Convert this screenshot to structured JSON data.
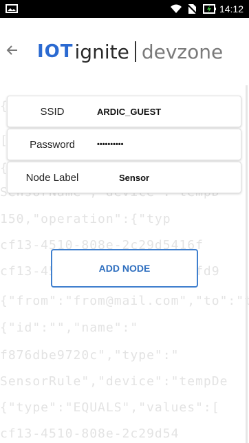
{
  "status_bar": {
    "time": "14:12",
    "icons": [
      "image-icon",
      "wifi-icon",
      "no-sim-icon",
      "battery-charging-icon"
    ]
  },
  "header": {
    "logo_iot": "IOT",
    "logo_ignite": "ignite",
    "logo_devzone": "devzone"
  },
  "form": {
    "ssid_label": "SSID",
    "ssid_value": "ARDIC_GUEST",
    "password_label": "Password",
    "password_value": "••••••••••",
    "node_label_label": "Node Label",
    "node_label_value": "Sensor"
  },
  "add_node_label": "ADD NODE",
  "background_code_lines": [
    "{\"",
    "[",
    "{\"",
    "SensorName\",\"device\":\"tempD",
    "150,\"operation\":{\"typ",
    "cf13-4510-808e-2c29d5416f",
    "cf13-4510-808e-2c29d5416fd9",
    "{\"from\":\"from@mail.com\",\"to\":\"to",
    "{\"id\":\"\",\"name\":\"",
    "f876dbe9720c\",\"type\":\"",
    "SensorRule\",\"device\":\"tempDe",
    "{\"type\":\"EQUALS\",\"values\":[",
    "cf13-4510-808e-2c29d54"
  ],
  "colors": {
    "brand_blue": "#2b6ad1",
    "button_blue": "#3f7fce",
    "bg_code": "#e3e3e3"
  }
}
